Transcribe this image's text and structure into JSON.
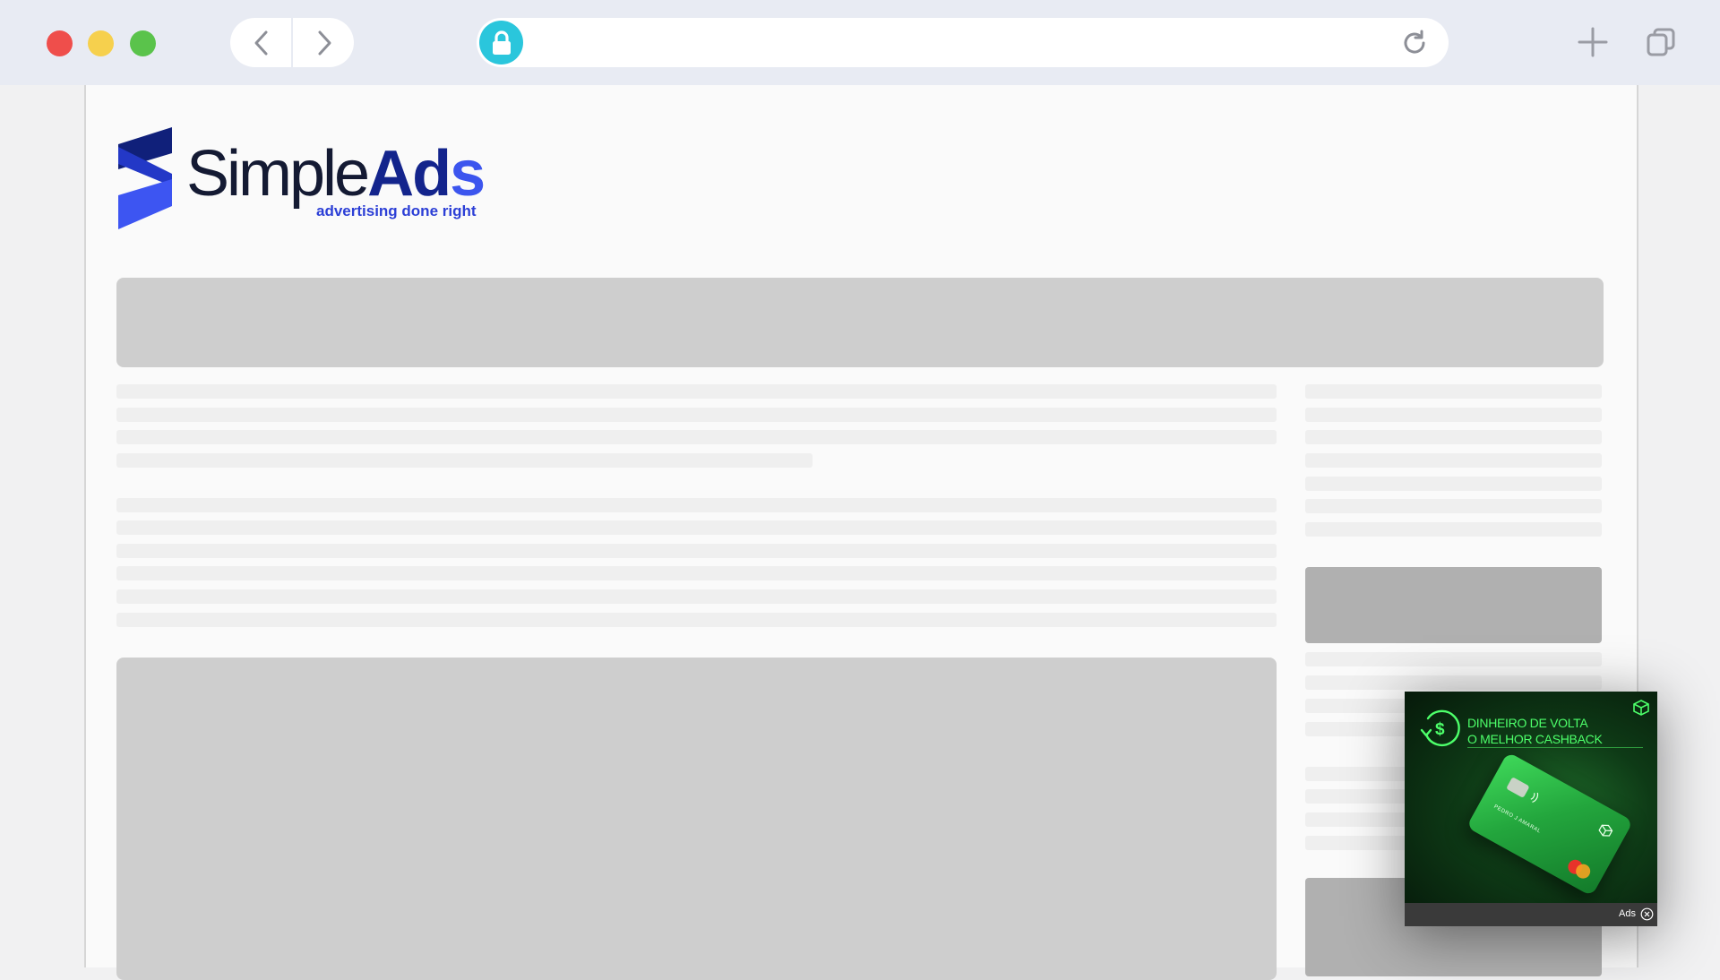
{
  "browser": {
    "url": "",
    "traffic_lights": [
      "#ef4e4b",
      "#f6d04d",
      "#5ac34b"
    ],
    "lock_color": "#2ac6dc"
  },
  "site": {
    "logo_word_simple": "Simple",
    "logo_word_ads_a": "Ad",
    "logo_word_ads_s": "s",
    "tagline": "advertising done right",
    "brand_colors": {
      "dark": "#13248c",
      "accent": "#3c55ee"
    }
  },
  "ad": {
    "headline_line1": "DINHEIRO DE VOLTA",
    "headline_line2": "O MELHOR CASHBACK",
    "card_name": "PEDRO J AMARAL",
    "label": "Ads",
    "accent_color": "#4dff6a"
  }
}
